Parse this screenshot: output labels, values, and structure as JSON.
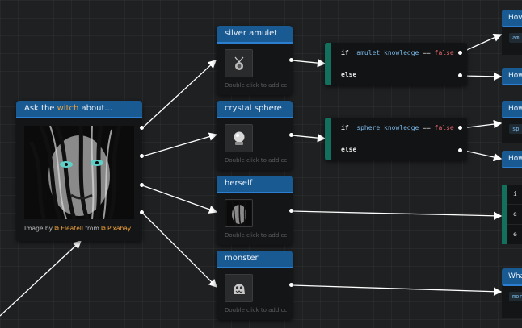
{
  "witch_node": {
    "title_prefix": "Ask the ",
    "title_highlight": "witch",
    "title_suffix": " about...",
    "credit_prefix": "Image by ",
    "credit_author": "Eleatell",
    "credit_mid": " from ",
    "credit_source": "Pixabay"
  },
  "choice_nodes": [
    {
      "title": "silver amulet",
      "hint": "Double click to add cc",
      "icon": "amulet-icon"
    },
    {
      "title": "crystal sphere",
      "hint": "Double click to add cc",
      "icon": "crystal-ball-icon"
    },
    {
      "title": "herself",
      "hint": "Double click to add cc",
      "icon": "witch-portrait-icon"
    },
    {
      "title": "monster",
      "hint": "Double click to add cc",
      "icon": "monster-icon"
    }
  ],
  "conditions": [
    {
      "if_kw": "if",
      "var": "amulet_knowledge",
      "op": "==",
      "lit": "false",
      "else_kw": "else"
    },
    {
      "if_kw": "if",
      "var": "sphere_knowledge",
      "op": "==",
      "lit": "false",
      "else_kw": "else"
    }
  ],
  "right_edge": {
    "headers": [
      "Hov",
      "How",
      "How",
      "How",
      "Wha"
    ],
    "chips": [
      "am",
      "sp",
      "mor"
    ],
    "partial_rows": [
      "i",
      "e",
      "e"
    ]
  },
  "colors": {
    "header": "#1a5a93",
    "condition_bar": "#12705c",
    "accent": "#f0a23a"
  }
}
